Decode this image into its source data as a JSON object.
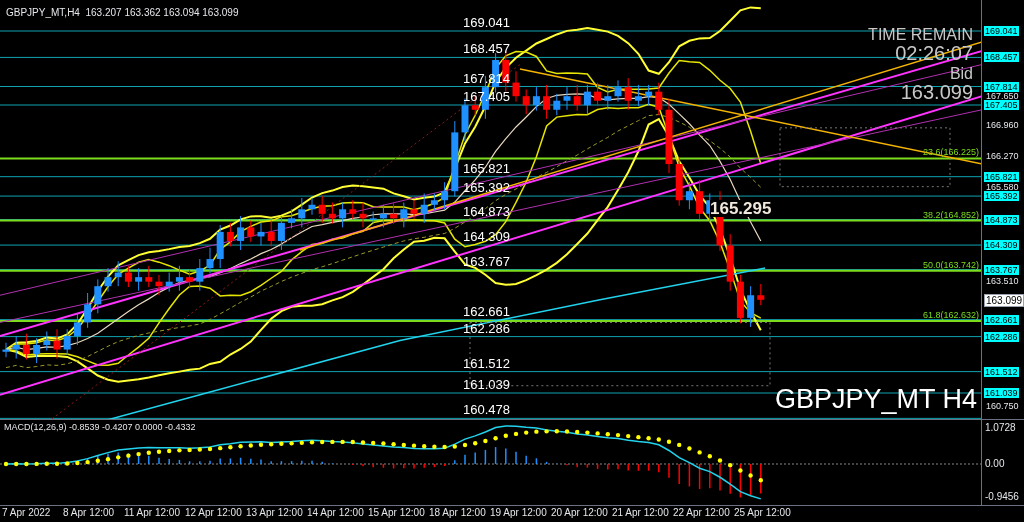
{
  "header": {
    "symbol": "GBPJPY_MT,H4",
    "open": "163.207",
    "high": "163.362",
    "low": "163.094",
    "close": "163.099"
  },
  "levels": [
    {
      "label": "169.041",
      "tag": "169.041"
    },
    {
      "label": "168.457",
      "tag": "168.457"
    },
    {
      "label": "167.814",
      "tag": "167.814"
    },
    {
      "label": "167.405",
      "tag": "167.405"
    },
    {
      "label": "165.821",
      "tag": "165.821"
    },
    {
      "label": "165.392",
      "tag": "165.392"
    },
    {
      "label": "164.873",
      "tag": "164.873"
    },
    {
      "label": "164.309",
      "tag": "164.309"
    },
    {
      "label": "163.767",
      "tag": "163.767"
    },
    {
      "label": "162.661",
      "tag": "162.661"
    },
    {
      "label": "162.286",
      "tag": "162.286"
    },
    {
      "label": "161.512",
      "tag": "161.512"
    },
    {
      "label": "161.039",
      "tag": "161.039"
    },
    {
      "label": "160.478"
    }
  ],
  "fibonacci": [
    {
      "label": "23.6(166.225)"
    },
    {
      "label": "38.2(164.852)"
    },
    {
      "label": "50.0(163.742)"
    },
    {
      "label": "61.8(162.632)"
    }
  ],
  "price_axis": [
    "167.650",
    "166.960",
    "166.270",
    "165.580",
    "163.510",
    "160.750"
  ],
  "bid_tag": "163.099",
  "timer": {
    "caption": "TIME REMAIN",
    "value": "02:26:07"
  },
  "bid": {
    "caption": "Bid",
    "value": "163.099"
  },
  "callout": "165.295",
  "chart_label": "GBPJPY_MT H4",
  "macd": {
    "legend": "MACD(12,26,9) -0.8539 -0.4207 0.0000 -0.4332",
    "axis": [
      "1.0728",
      "0.00",
      "-0.9456"
    ]
  },
  "time_axis": [
    "7 Apr 2022",
    "8 Apr 12:00",
    "11 Apr 12:00",
    "12 Apr 12:00",
    "13 Apr 12:00",
    "14 Apr 12:00",
    "15 Apr 12:00",
    "18 Apr 12:00",
    "19 Apr 12:00",
    "20 Apr 12:00",
    "21 Apr 12:00",
    "22 Apr 12:00",
    "25 Apr 12:00"
  ]
}
